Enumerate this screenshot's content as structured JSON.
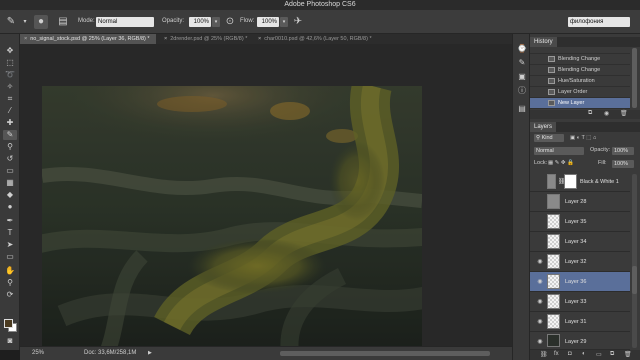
{
  "app": {
    "title": "Adobe Photoshop CS6"
  },
  "options": {
    "mode_label": "Mode:",
    "mode_value": "Normal",
    "opacity_label": "Opacity:",
    "opacity_value": "100%",
    "flow_label": "Flow:",
    "flow_value": "100%",
    "workspace_value": "филофония"
  },
  "tabs": [
    {
      "label": "no_signal_stock.psd @ 25% (Layer 36, RGB/8) *",
      "active": true
    },
    {
      "label": "2drender.psd @ 25% (RGB/8) *",
      "active": false
    },
    {
      "label": "char0010.psd @ 42,6% (Layer 50, RGB/8) *",
      "active": false
    }
  ],
  "status": {
    "zoom": "25%",
    "doc": "Doc: 33,6M/258,1M"
  },
  "history": {
    "tab_label": "History",
    "items": [
      {
        "label": "Blending Change",
        "selected": false
      },
      {
        "label": "Blending Change",
        "selected": false
      },
      {
        "label": "Hue/Saturation",
        "selected": false
      },
      {
        "label": "Layer Order",
        "selected": false
      },
      {
        "label": "New Layer",
        "selected": true
      }
    ]
  },
  "layers": {
    "tab_label": "Layers",
    "kind_label": "Kind",
    "blend_value": "Normal",
    "opacity_label": "Opacity:",
    "opacity_value": "100%",
    "lock_label": "Lock:",
    "fill_label": "Fill:",
    "fill_value": "100%",
    "items": [
      {
        "name": "Black & White 1",
        "visible": false,
        "thumb": "adjust",
        "selected": false
      },
      {
        "name": "Layer 28",
        "visible": false,
        "thumb": "gray",
        "selected": false
      },
      {
        "name": "Layer 35",
        "visible": false,
        "thumb": "checker",
        "selected": false
      },
      {
        "name": "Layer 34",
        "visible": false,
        "thumb": "checker",
        "selected": false
      },
      {
        "name": "Layer 32",
        "visible": true,
        "thumb": "checker",
        "selected": false
      },
      {
        "name": "Layer 36",
        "visible": true,
        "thumb": "checker",
        "selected": true
      },
      {
        "name": "Layer 33",
        "visible": true,
        "thumb": "checker",
        "selected": false
      },
      {
        "name": "Layer 31",
        "visible": true,
        "thumb": "checker",
        "selected": false
      },
      {
        "name": "Layer 29",
        "visible": true,
        "thumb": "dark",
        "selected": false
      }
    ]
  },
  "icons": {
    "eye": "👁",
    "close": "×",
    "caret": "▾",
    "brush": "✎",
    "fx": "fx"
  }
}
